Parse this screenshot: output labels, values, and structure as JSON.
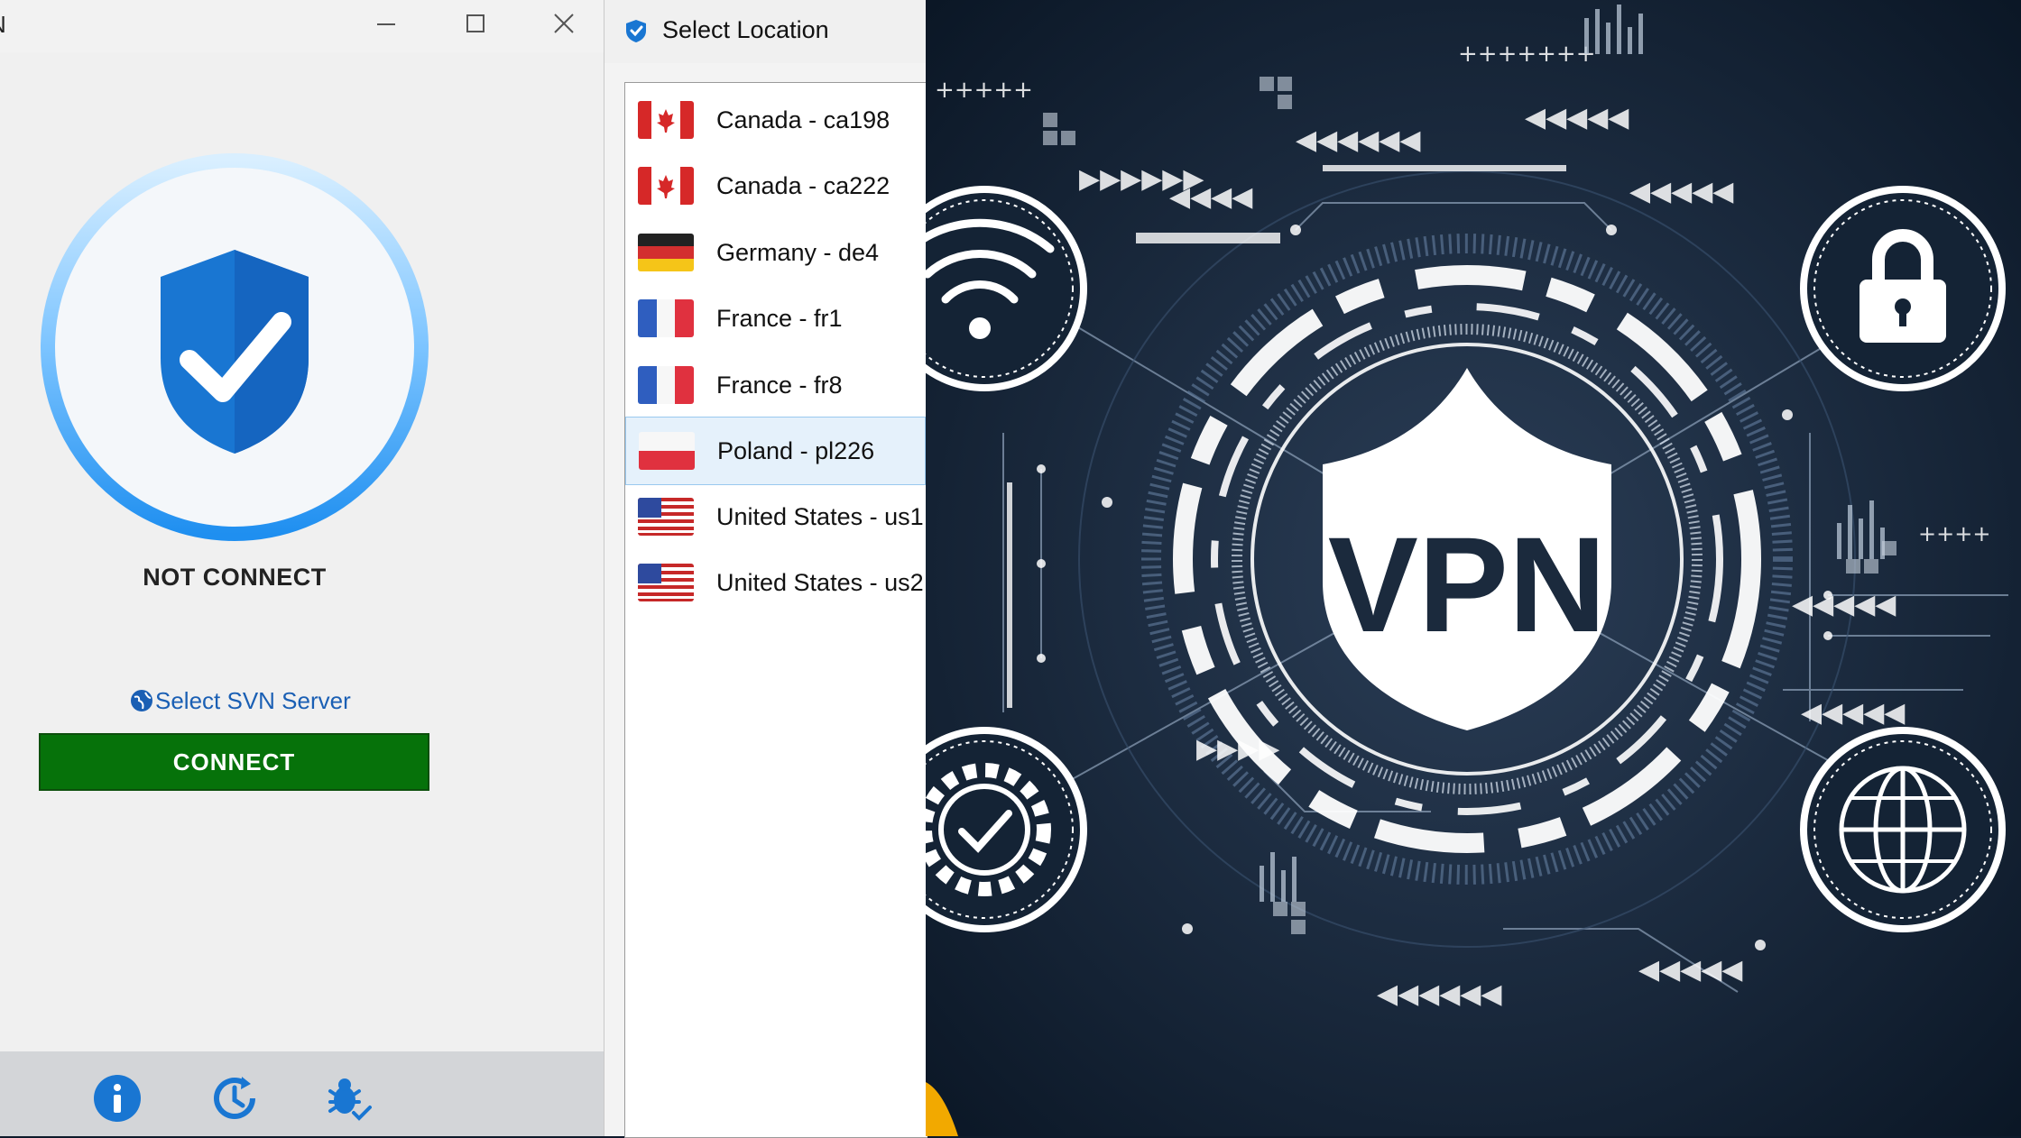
{
  "window": {
    "title": "N"
  },
  "status": {
    "text": "NOT CONNECT"
  },
  "server": {
    "select_label": "Select SVN Server"
  },
  "connect": {
    "label": "CONNECT"
  },
  "bottom_icons": [
    "info-icon",
    "refresh-clock-icon",
    "bug-icon"
  ],
  "location": {
    "title": "Select Location",
    "items": [
      {
        "label": "Canada - ca198",
        "flag": "canada"
      },
      {
        "label": "Canada - ca222",
        "flag": "canada"
      },
      {
        "label": "Germany - de4",
        "flag": "germany"
      },
      {
        "label": "France - fr1",
        "flag": "france"
      },
      {
        "label": "France - fr8",
        "flag": "france"
      },
      {
        "label": "Poland - pl226",
        "flag": "poland",
        "selected": true
      },
      {
        "label": "United States - us1",
        "flag": "usa"
      },
      {
        "label": "United States - us2",
        "flag": "usa"
      }
    ]
  },
  "banner": {
    "text": "VPN"
  },
  "colors": {
    "connect_button": "#06720a",
    "ring": "#3aa0f0",
    "shield": "#1976d2",
    "link": "#1a5fb4"
  }
}
